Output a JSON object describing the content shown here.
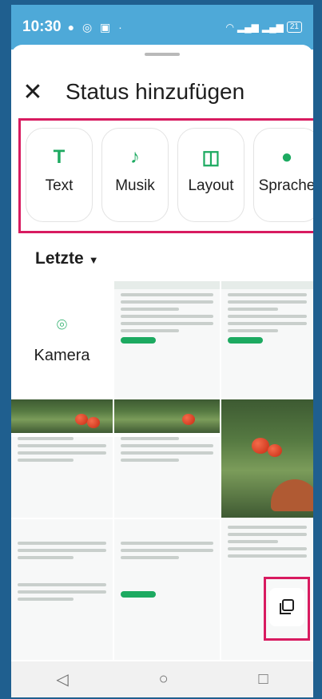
{
  "status_bar": {
    "time": "10:30",
    "battery": "21"
  },
  "header": {
    "close_icon": "close-icon",
    "title": "Status hinzufügen"
  },
  "options": [
    {
      "label": "Text",
      "icon": "text-icon"
    },
    {
      "label": "Musik",
      "icon": "music-icon"
    },
    {
      "label": "Layout",
      "icon": "layout-icon"
    },
    {
      "label": "Sprache",
      "icon": "microphone-icon"
    }
  ],
  "recent": {
    "label": "Letzte"
  },
  "gallery": {
    "camera_label": "Kamera"
  },
  "colors": {
    "accent": "#1daa61",
    "highlight": "#d81b60",
    "status_bar": "#4ea9d8"
  },
  "nav": {
    "back_icon": "back-icon",
    "home_icon": "home-icon",
    "recents_icon": "recents-icon"
  }
}
